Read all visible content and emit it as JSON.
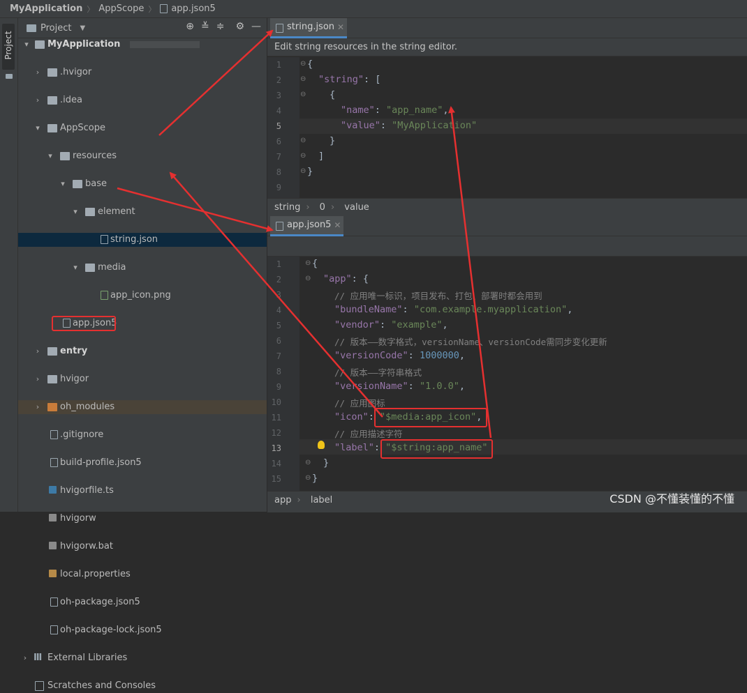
{
  "breadcrumb": [
    "MyApplication",
    "AppScope",
    "app.json5"
  ],
  "toolstrip": {
    "project_tab": "Project"
  },
  "project_panel": {
    "title": "Project",
    "tools": [
      "target-icon",
      "expand-all-icon",
      "collapse-all-icon",
      "gear-icon",
      "minimize-icon"
    ],
    "tree": [
      {
        "label": "MyApplication",
        "bold": true
      },
      {
        "label": ".hvigor"
      },
      {
        "label": ".idea"
      },
      {
        "label": "AppScope"
      },
      {
        "label": "resources"
      },
      {
        "label": "base"
      },
      {
        "label": "element"
      },
      {
        "label": "string.json",
        "selected": true
      },
      {
        "label": "media"
      },
      {
        "label": "app_icon.png"
      },
      {
        "label": "app.json5",
        "boxed": true
      },
      {
        "label": "entry",
        "bold": true
      },
      {
        "label": "hvigor"
      },
      {
        "label": "oh_modules",
        "highlight": true
      },
      {
        "label": ".gitignore"
      },
      {
        "label": "build-profile.json5"
      },
      {
        "label": "hvigorfile.ts"
      },
      {
        "label": "hvigorw"
      },
      {
        "label": "hvigorw.bat"
      },
      {
        "label": "local.properties"
      },
      {
        "label": "oh-package.json5"
      },
      {
        "label": "oh-package-lock.json5"
      },
      {
        "label": "External Libraries"
      },
      {
        "label": "Scratches and Consoles"
      }
    ]
  },
  "editor_top": {
    "tab": "string.json",
    "notice": "Edit string resources in the string editor.",
    "lines": [
      "1",
      "2",
      "3",
      "4",
      "5",
      "6",
      "7",
      "8",
      "9"
    ],
    "status": [
      "string",
      "0",
      "value"
    ],
    "code": {
      "l1": "{",
      "l2_key": "\"string\"",
      "l2_rest": ": [",
      "l3": "{",
      "l4_key": "\"name\"",
      "l4_sep": ": ",
      "l4_val": "\"app_name\"",
      "l4_end": ",",
      "l5_key": "\"value\"",
      "l5_sep": ": ",
      "l5_val": "\"MyApplication\"",
      "l6": "}",
      "l7": "]",
      "l8": "}"
    }
  },
  "editor_bottom": {
    "tab": "app.json5",
    "lines": [
      "1",
      "2",
      "3",
      "4",
      "5",
      "6",
      "7",
      "8",
      "9",
      "10",
      "11",
      "12",
      "13",
      "14",
      "15"
    ],
    "status": [
      "app",
      "label"
    ],
    "code": {
      "l1": "{",
      "l2_key": "\"app\"",
      "l2_rest": ": {",
      "l3": "// 应用唯一标识，项目发布、打包、部署时都会用到",
      "l4_key": "\"bundleName\"",
      "l4_val": "\"com.example.myapplication\"",
      "l5_key": "\"vendor\"",
      "l5_val": "\"example\"",
      "l6": "// 版本——数字格式，versionName、versionCode需同步变化更新",
      "l7_key": "\"versionCode\"",
      "l7_val": "1000000",
      "l8": "// 版本——字符串格式",
      "l9_key": "\"versionName\"",
      "l9_val": "\"1.0.0\"",
      "l10": "// 应用图标",
      "l11_key": "\"icon\"",
      "l11_val": "\"$media:app_icon\"",
      "l12": "// 应用描述字符",
      "l13_key": "\"label\"",
      "l13_val": "\"$string:app_name\"",
      "l14": "}",
      "l15": "}",
      "colon": ": ",
      "comma": ","
    }
  },
  "watermark": "CSDN @不懂装懂的不懂",
  "colors": {
    "annotation_red": "#e53030",
    "keyword": "#9876aa",
    "string": "#6a8759",
    "number": "#6897bb"
  }
}
